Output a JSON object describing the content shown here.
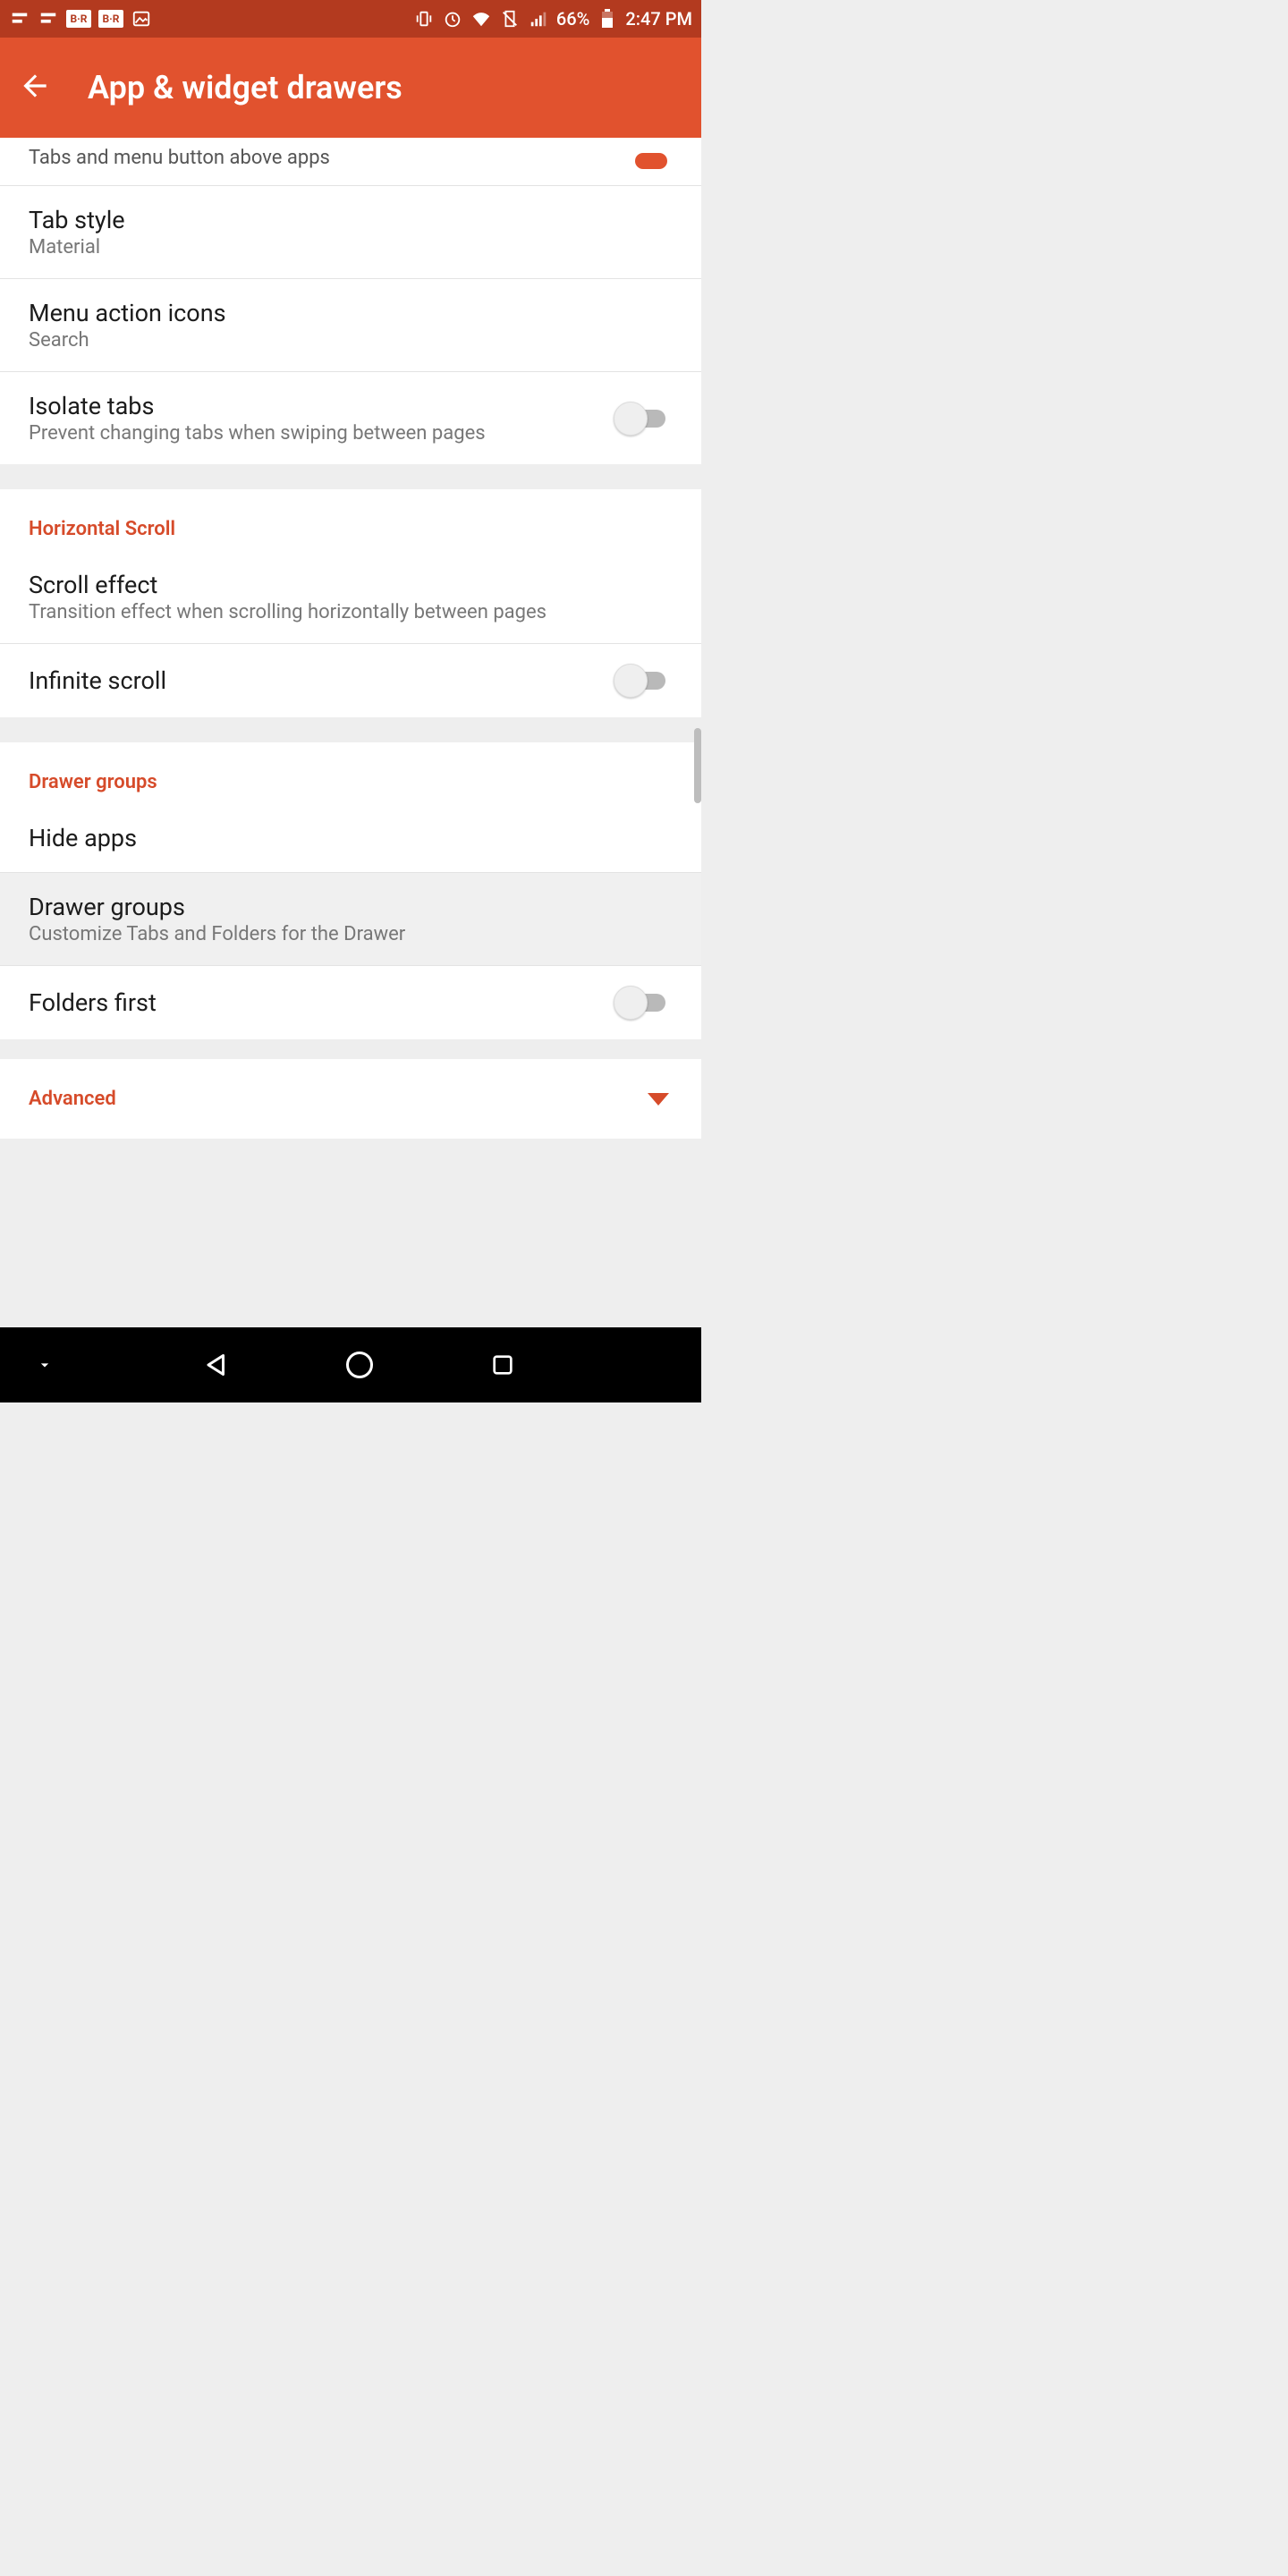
{
  "status": {
    "battery": "66%",
    "time": "2:47 PM"
  },
  "appbar": {
    "title": "App & widget drawers"
  },
  "partial": {
    "label": "Tabs and menu button above apps"
  },
  "items": {
    "tabstyle": {
      "title": "Tab style",
      "sub": "Material"
    },
    "menuicons": {
      "title": "Menu action icons",
      "sub": "Search"
    },
    "isolate": {
      "title": "Isolate tabs",
      "sub": "Prevent changing tabs when swiping between pages"
    },
    "hscroll_header": "Horizontal Scroll",
    "scrolleffect": {
      "title": "Scroll effect",
      "sub": "Transition effect when scrolling horizontally between pages"
    },
    "infinite": {
      "title": "Infinite scroll"
    },
    "drawer_header": "Drawer groups",
    "hideapps": {
      "title": "Hide apps"
    },
    "drawergroups": {
      "title": "Drawer groups",
      "sub": "Customize Tabs and Folders for the Drawer"
    },
    "foldersfirst": {
      "title": "Folders first"
    },
    "advanced": "Advanced"
  }
}
